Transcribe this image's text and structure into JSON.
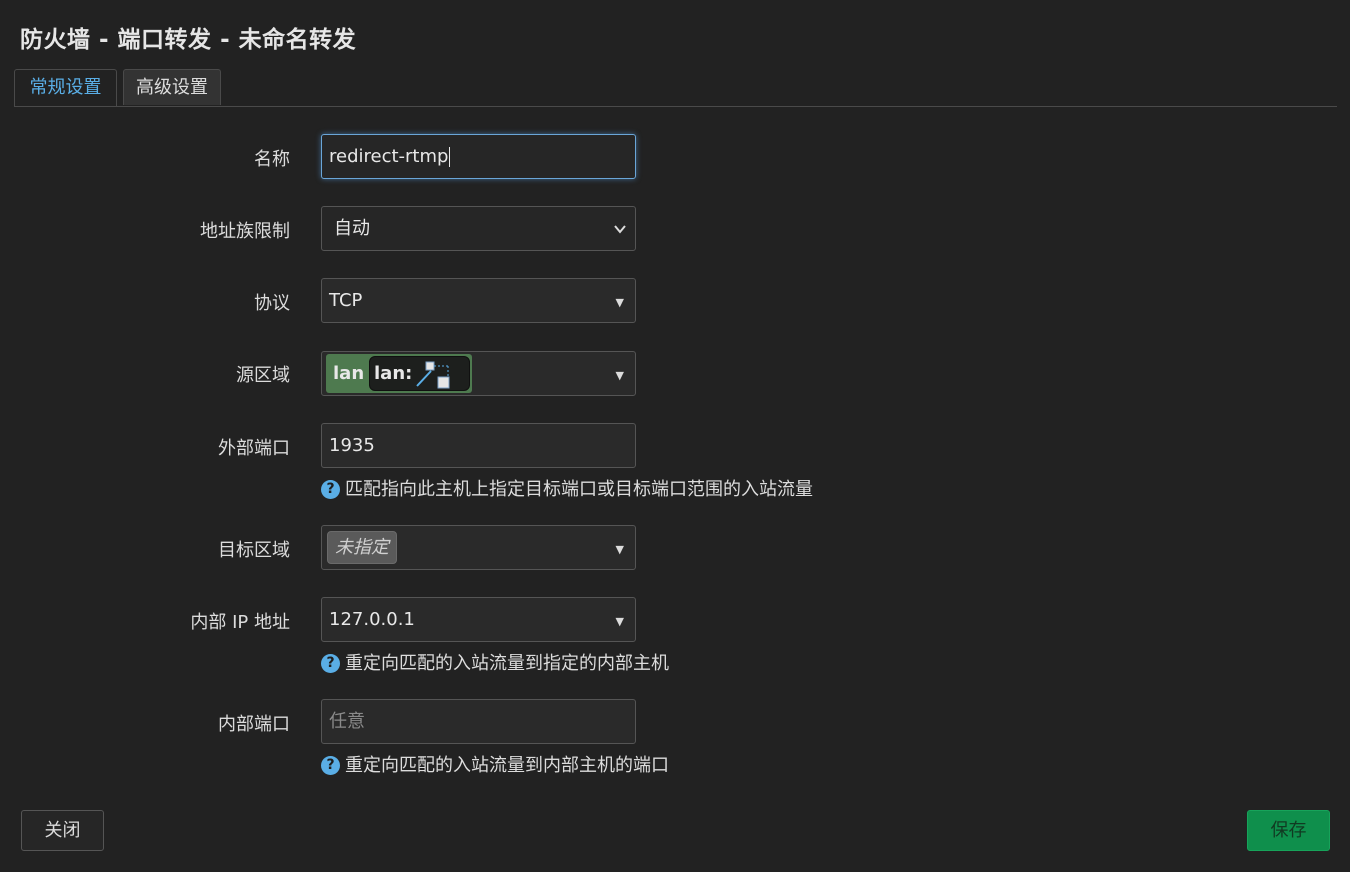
{
  "title": "防火墙 - 端口转发 - 未命名转发",
  "tabs": [
    {
      "label": "常规设置",
      "active": true
    },
    {
      "label": "高级设置",
      "active": false
    }
  ],
  "fields": {
    "name": {
      "label": "名称",
      "value": "redirect-rtmp"
    },
    "family": {
      "label": "地址族限制",
      "value": "自动"
    },
    "protocol": {
      "label": "协议",
      "value": "TCP"
    },
    "src_zone": {
      "label": "源区域",
      "chip": "lan",
      "inner_chip": "lan:"
    },
    "ext_port": {
      "label": "外部端口",
      "value": "1935",
      "help": "匹配指向此主机上指定目标端口或目标端口范围的入站流量"
    },
    "dest_zone": {
      "label": "目标区域",
      "chip": "未指定"
    },
    "int_ip": {
      "label": "内部 IP 地址",
      "value": "127.0.0.1",
      "help": "重定向匹配的入站流量到指定的内部主机"
    },
    "int_port": {
      "label": "内部端口",
      "placeholder": "任意",
      "help": "重定向匹配的入站流量到内部主机的端口"
    }
  },
  "help_icon": "?",
  "buttons": {
    "close": "关闭",
    "save": "保存"
  },
  "colors": {
    "accent": "#5aaee6",
    "zone_lan": "#4e7a4f",
    "save": "#0f8f4c"
  }
}
